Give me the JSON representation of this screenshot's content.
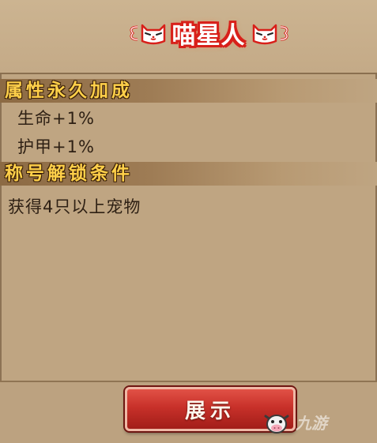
{
  "title": {
    "text": "喵星人",
    "color": "#ffffff",
    "outline_color": "#d8201a",
    "left_icon": "lucky-cat-icon",
    "right_icon": "lucky-cat-icon"
  },
  "sections": [
    {
      "title": "属性永久加成",
      "items": [
        "生命+1%",
        "护甲+1%"
      ]
    },
    {
      "title": "称号解锁条件",
      "items": [
        "获得4只以上宠物"
      ]
    }
  ],
  "button": {
    "label": "展示",
    "color": "#c8312a"
  },
  "watermark": {
    "icon": "cow-mascot-icon",
    "text": "九游"
  },
  "colors": {
    "panel": "#bfa582",
    "section_title": "#ffd04a"
  }
}
